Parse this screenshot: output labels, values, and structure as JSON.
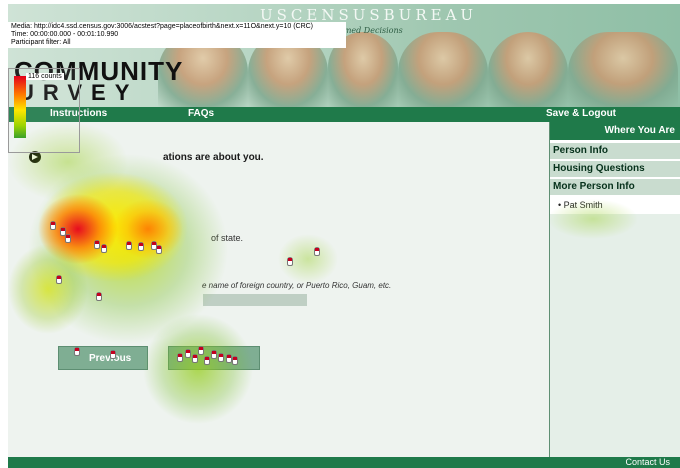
{
  "overlay": {
    "media": "Media: http://idc4.ssd.census.gov:3006/acstest?page=placeofbirth&next.x=11O&next.y=10 (CRC)",
    "time": "Time: 00:00:00.000 - 00:01:10.990",
    "participant": "Participant filter: All",
    "legend_label": "116 counts",
    "legend_colors": [
      "#e3001b",
      "#ff7a00",
      "#ffe600",
      "#9bd400",
      "#3aa02a"
    ]
  },
  "header": {
    "bureau": "USCENSUSBUREAU",
    "tagline": "rmed Decisions",
    "logo_line1": "COMMUNITY",
    "logo_line2": "URVEY"
  },
  "nav": {
    "instructions": "Instructions",
    "faqs": "FAQs",
    "save_logout": "Save & Logout"
  },
  "sidebar": {
    "title": "Where You Are",
    "items": [
      "Person Info",
      "Housing Questions",
      "More Person Info"
    ],
    "subitem": "• Pat Smith"
  },
  "main": {
    "question": "ations are about you.",
    "option_state": "of state.",
    "option_foreign": "e name of foreign country, or Puerto Rico, Guam, etc.",
    "previous_label": "Previous",
    "next_label": ""
  },
  "footer": {
    "contact": "Contact Us"
  },
  "colors": {
    "nav_green": "#1f7a4a",
    "sidebar_item_bg": "#c9dccf",
    "heat_red": "#e3001b",
    "heat_yellow": "#ffe600",
    "heat_green": "#3aa02a"
  }
}
